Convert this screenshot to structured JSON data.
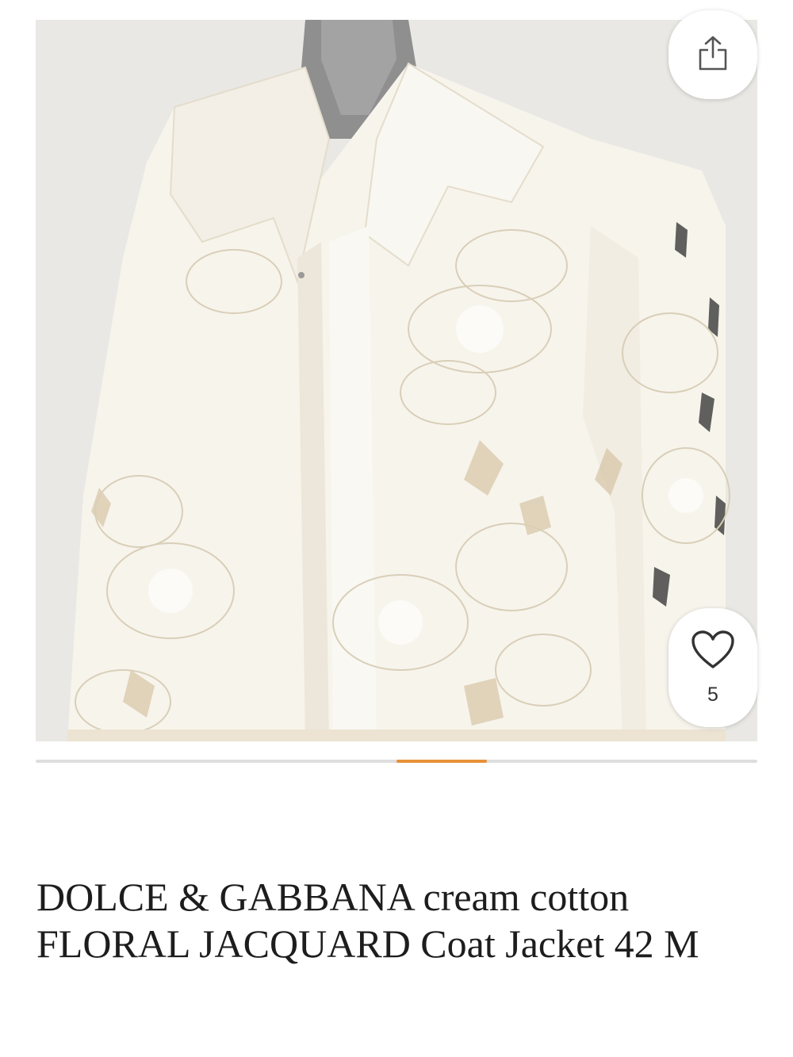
{
  "listing": {
    "title": "DOLCE & GABBANA cream cotton FLORAL JACQUARD Coat Jacket 42 M",
    "image_alt": "Cream floral jacquard coat with cut-out flowers on a grey mannequin",
    "like_count": "5"
  },
  "gallery": {
    "progress_fraction": 0.125,
    "progress_offset_fraction": 0.5
  },
  "icons": {
    "share": "share-icon",
    "like": "heart-outline-icon"
  },
  "colors": {
    "accent": "#e8913a",
    "track": "#dedede",
    "text": "#1d1d1d"
  }
}
